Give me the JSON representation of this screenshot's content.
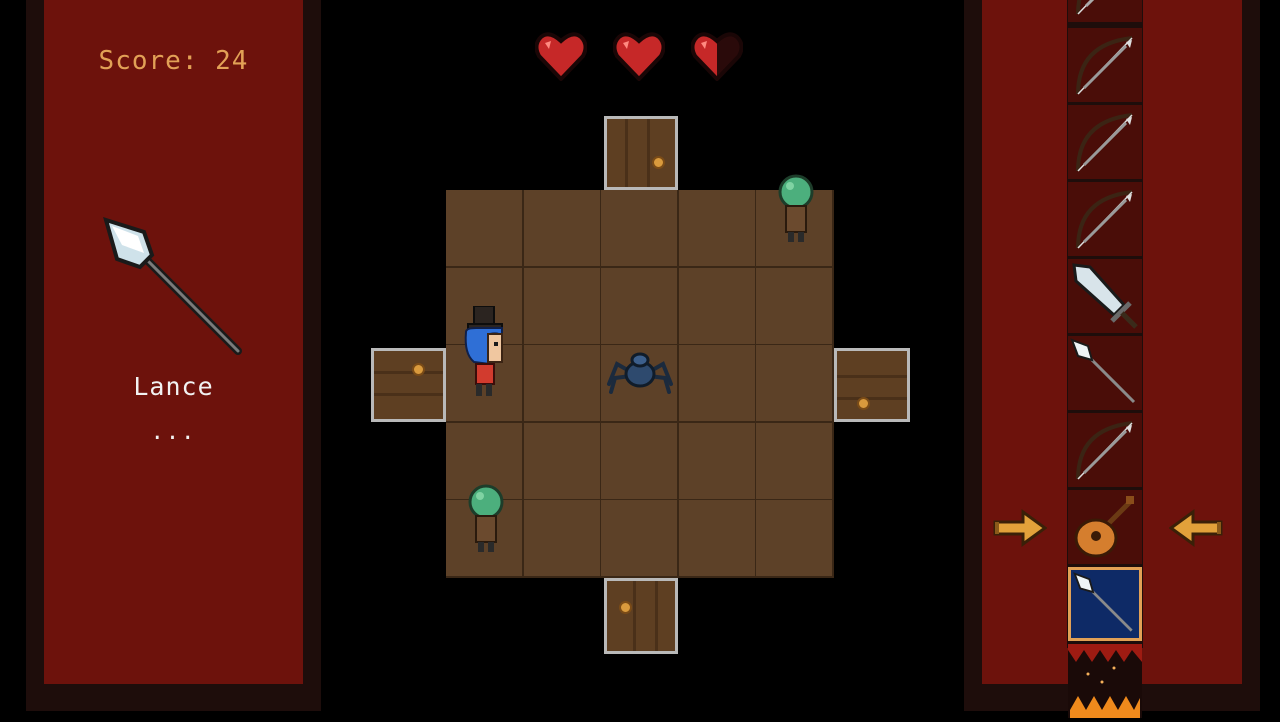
{
  "hud": {
    "score_text": "Score: 24",
    "hearts": [
      {
        "fill": 1.0
      },
      {
        "fill": 1.0
      },
      {
        "fill": 0.5
      }
    ]
  },
  "selected_item": {
    "name": "Lance",
    "description": "...",
    "icon": "lance-icon"
  },
  "inventory": {
    "slots": [
      {
        "icon": "bow-icon"
      },
      {
        "icon": "bow-icon"
      },
      {
        "icon": "bow-icon"
      },
      {
        "icon": "sword-icon"
      },
      {
        "icon": "spear-icon"
      },
      {
        "icon": "bow-icon"
      },
      {
        "icon": "lute-icon"
      },
      {
        "icon": "spear-icon",
        "selected": true
      },
      {
        "icon": "spike-trap-icon"
      }
    ]
  },
  "room": {
    "grid": [
      5,
      5
    ],
    "doors": [
      "north",
      "east",
      "south",
      "west"
    ],
    "entities": [
      {
        "type": "player-top-hat-blue-hair",
        "cell": [
          0,
          2
        ]
      },
      {
        "type": "spider-enemy",
        "cell": [
          2,
          2
        ]
      },
      {
        "type": "tree-zombie-enemy",
        "cell": [
          4,
          0
        ]
      },
      {
        "type": "tree-zombie-enemy",
        "cell": [
          0,
          4
        ]
      }
    ]
  },
  "colors": {
    "panel": "#6d120c",
    "frame": "#1e0d0b",
    "score": "#e2a156",
    "floor": "#5d4128",
    "selected_slot": "#0e2a66"
  }
}
